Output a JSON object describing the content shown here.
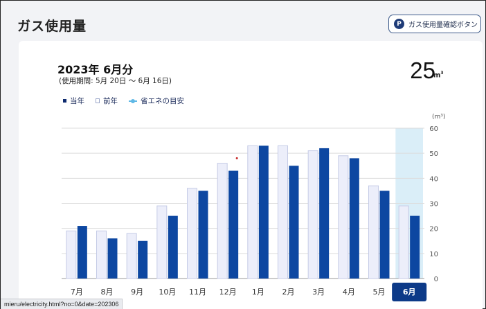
{
  "header": {
    "title": "ガス使用量",
    "confirm_button_icon": "P",
    "confirm_button_label": "ガス使用量確認ボタン"
  },
  "summary": {
    "period_title": "2023年 6月分",
    "period_range": "(使用期間: 5月 20日 〜 6月 16日)",
    "usage_value": "25",
    "usage_unit": "m",
    "usage_unit_sup": "3"
  },
  "legend": {
    "current": "当年",
    "previous": "前年",
    "eco": "省エネの目安"
  },
  "colors": {
    "current": "#0d47a1",
    "previous": "#eceefa",
    "previous_border": "#c5cbe6",
    "highlight": "#daeef8",
    "selected_label_bg": "#0d3a88"
  },
  "chart_data": {
    "type": "bar",
    "categories": [
      "7月",
      "8月",
      "9月",
      "10月",
      "11月",
      "12月",
      "1月",
      "2月",
      "3月",
      "4月",
      "5月",
      "6月"
    ],
    "series": [
      {
        "name": "前年",
        "values": [
          19,
          19,
          18,
          29,
          36,
          46,
          53,
          53,
          51,
          49,
          37,
          29
        ]
      },
      {
        "name": "当年",
        "values": [
          21,
          16,
          15,
          25,
          35,
          43,
          53,
          45,
          52,
          48,
          35,
          25
        ]
      }
    ],
    "eco_marker": {
      "category": "12月",
      "value": 48
    },
    "selected_category": "6月",
    "ylabel": "(m³)",
    "ylim": [
      0,
      60
    ],
    "yticks": [
      0,
      10,
      20,
      30,
      40,
      50,
      60
    ],
    "grid": true
  },
  "status_bar": {
    "url": "mieru/electricity.html?no=0&date=202306"
  }
}
